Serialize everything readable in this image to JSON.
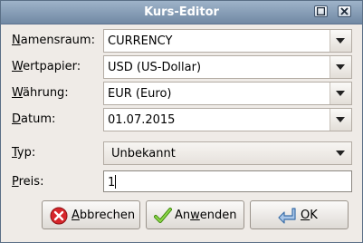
{
  "window": {
    "title": "Kurs-Editor"
  },
  "fields": [
    {
      "label": "Namensraum:",
      "mnemonic": "N",
      "rest": "amensraum:",
      "value": "CURRENCY"
    },
    {
      "label": "Wertpapier:",
      "mnemonic": "W",
      "rest": "ertpapier:",
      "value": "USD (US-Dollar)"
    },
    {
      "label": "Währung:",
      "mnemonic": "W",
      "rest": "ährung:",
      "value": "EUR (Euro)"
    },
    {
      "label": "Datum:",
      "mnemonic": "D",
      "rest": "atum:",
      "value": "01.07.2015"
    },
    {
      "label": "Typ:",
      "mnemonic": "T",
      "rest": "yp:",
      "value": "Unbekannt"
    },
    {
      "label": "Preis:",
      "mnemonic": "P",
      "rest": "reis:",
      "value": "1"
    }
  ],
  "buttons": {
    "cancel": {
      "mnemonic": "A",
      "rest": "bbrechen",
      "label": "Abbrechen"
    },
    "apply": {
      "pre": "An",
      "mnemonic": "w",
      "rest": "enden",
      "label": "Anwenden"
    },
    "ok": {
      "mnemonic": "O",
      "rest": "K",
      "label": "OK"
    }
  },
  "colors": {
    "titlebar": "#7f97b2",
    "cancel_icon": "#d7262b",
    "apply_icon": "#57a816",
    "ok_icon": "#3a6ea8"
  }
}
